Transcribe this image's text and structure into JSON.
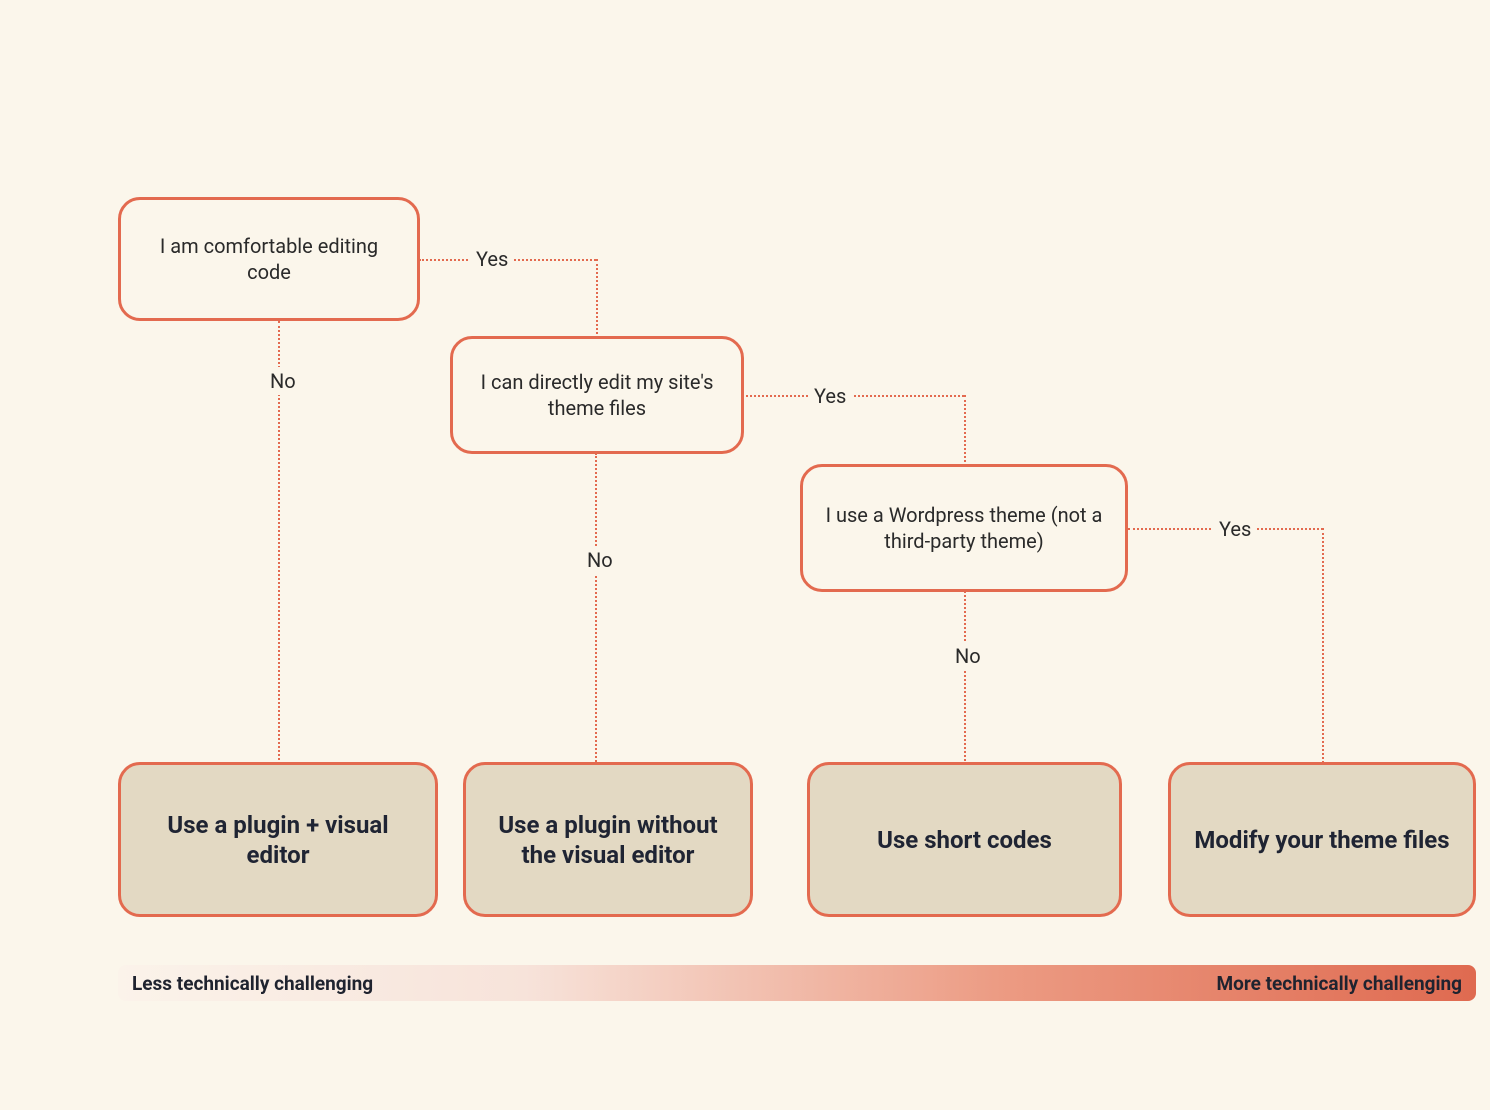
{
  "decisions": {
    "q1": "I am comfortable editing code",
    "q2": "I can directly edit my site's theme files",
    "q3": "I use a Wordpress theme (not a third-party theme)"
  },
  "answers": {
    "yes": "Yes",
    "no": "No"
  },
  "outcomes": {
    "o1": "Use a plugin + visual editor",
    "o2": "Use a plugin without the visual editor",
    "o3": "Use short codes",
    "o4": "Modify your theme files"
  },
  "scale": {
    "left": "Less technically challenging",
    "right": "More technically challenging"
  },
  "colors": {
    "accent": "#e36a4f",
    "background": "#fbf6eb",
    "outcome_fill": "#e3d9c3",
    "text_dark": "#1f2433"
  }
}
